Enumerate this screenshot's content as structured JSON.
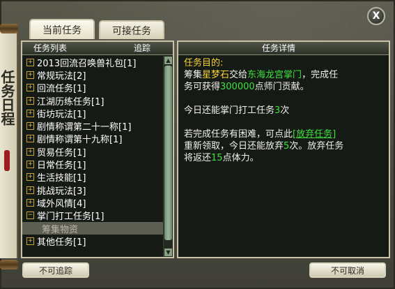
{
  "window": {
    "scroll_title": "任务日程",
    "close_label": "X"
  },
  "tabs": [
    {
      "label": "当前任务",
      "active": true
    },
    {
      "label": "可接任务",
      "active": false
    }
  ],
  "list_panel": {
    "header_title": "任务列表",
    "header_track": "追踪",
    "items": [
      {
        "expander": "+",
        "label": "2013回流召唤兽礼包[1]"
      },
      {
        "expander": "+",
        "label": "常规玩法[2]"
      },
      {
        "expander": "+",
        "label": "回流任务[1]"
      },
      {
        "expander": "+",
        "label": "江湖历练任务[1]"
      },
      {
        "expander": "+",
        "label": "街坊玩法[1]"
      },
      {
        "expander": "+",
        "label": "剧情称谓第二十一称[1]"
      },
      {
        "expander": "+",
        "label": "剧情称谓第十九称[1]"
      },
      {
        "expander": "+",
        "label": "贸易任务[1]"
      },
      {
        "expander": "+",
        "label": "日常任务[1]"
      },
      {
        "expander": "+",
        "label": "生活技能[1]"
      },
      {
        "expander": "+",
        "label": "挑战玩法[3]"
      },
      {
        "expander": "+",
        "label": "域外风情[4]"
      },
      {
        "expander": "−",
        "label": "掌门打工任务[1]"
      },
      {
        "expander": "",
        "label": "筹集物资",
        "sub": true
      },
      {
        "expander": "+",
        "label": "其他任务[1]"
      }
    ]
  },
  "detail_panel": {
    "header_title": "任务详情",
    "objective_label": "任务目的:",
    "line1_prefix": "筹集",
    "item_name": "星梦石",
    "line1_mid": "交给",
    "npc_name": "东海龙宫掌门",
    "line1_suffix": "，完成任",
    "line2_prefix": "务可获得",
    "reward_amount": "300000",
    "line2_suffix": "点师门贡献。",
    "today_prefix": "今日还能掌门打工任务",
    "today_count": "3",
    "today_suffix": "次",
    "abandon_line1": "若完成任务有困难，可点此",
    "abandon_link": "[放弃任务]",
    "abandon_line2_prefix": "重新领取，今日还能放弃",
    "abandon_count": "5",
    "abandon_line2_suffix": "次。放弃任务",
    "abandon_line3_prefix": "将返还",
    "stamina_amount": "15",
    "abandon_line3_suffix": "点体力。"
  },
  "buttons": {
    "untrack": "不可追踪",
    "cancel": "不可取消"
  },
  "colors": {
    "highlight_yellow": "#f6d23a",
    "highlight_green": "#3fe03f",
    "panel_border": "#c9c4a8"
  }
}
